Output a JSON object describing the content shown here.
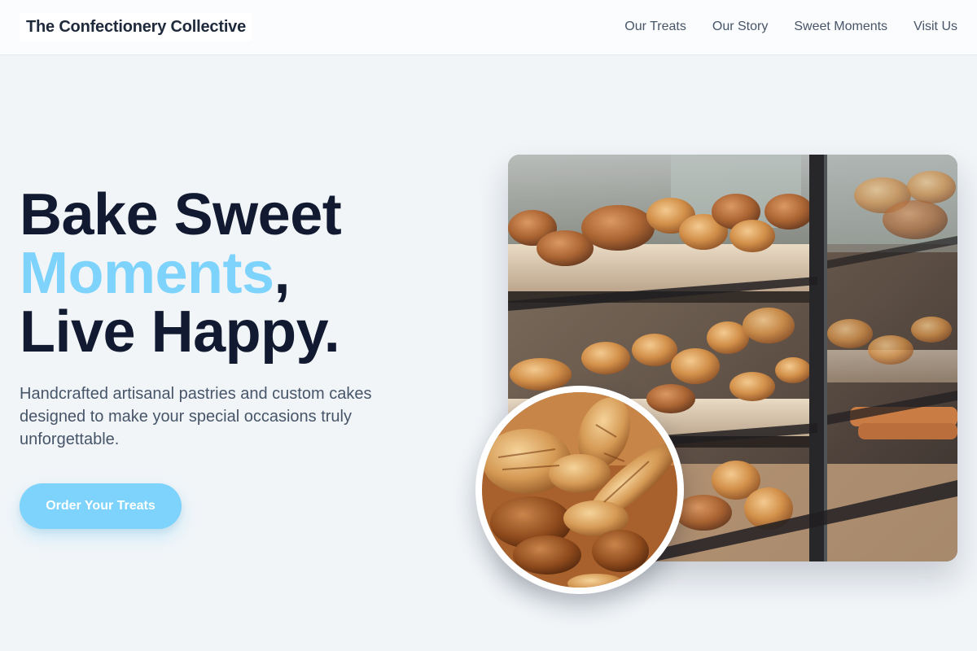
{
  "header": {
    "brand": "The Confectionery Collective",
    "nav": [
      "Our Treats",
      "Our Story",
      "Sweet Moments",
      "Visit Us"
    ]
  },
  "hero": {
    "headline_line1": "Bake Sweet",
    "headline_accent": "Moments",
    "headline_comma": ",",
    "headline_line3": "Live Happy.",
    "subtitle": "Handcrafted artisanal pastries and custom cakes designed to make your special occasions truly unforgettable.",
    "cta_label": "Order Your Treats"
  },
  "images": {
    "main_alt": "Bakery display case with breads and pastries",
    "circle_alt": "Assorted artisan breads close-up"
  },
  "colors": {
    "accent": "#7dd3fc",
    "heading": "#111a30",
    "body_text": "#475569",
    "background": "#f1f5f8"
  }
}
